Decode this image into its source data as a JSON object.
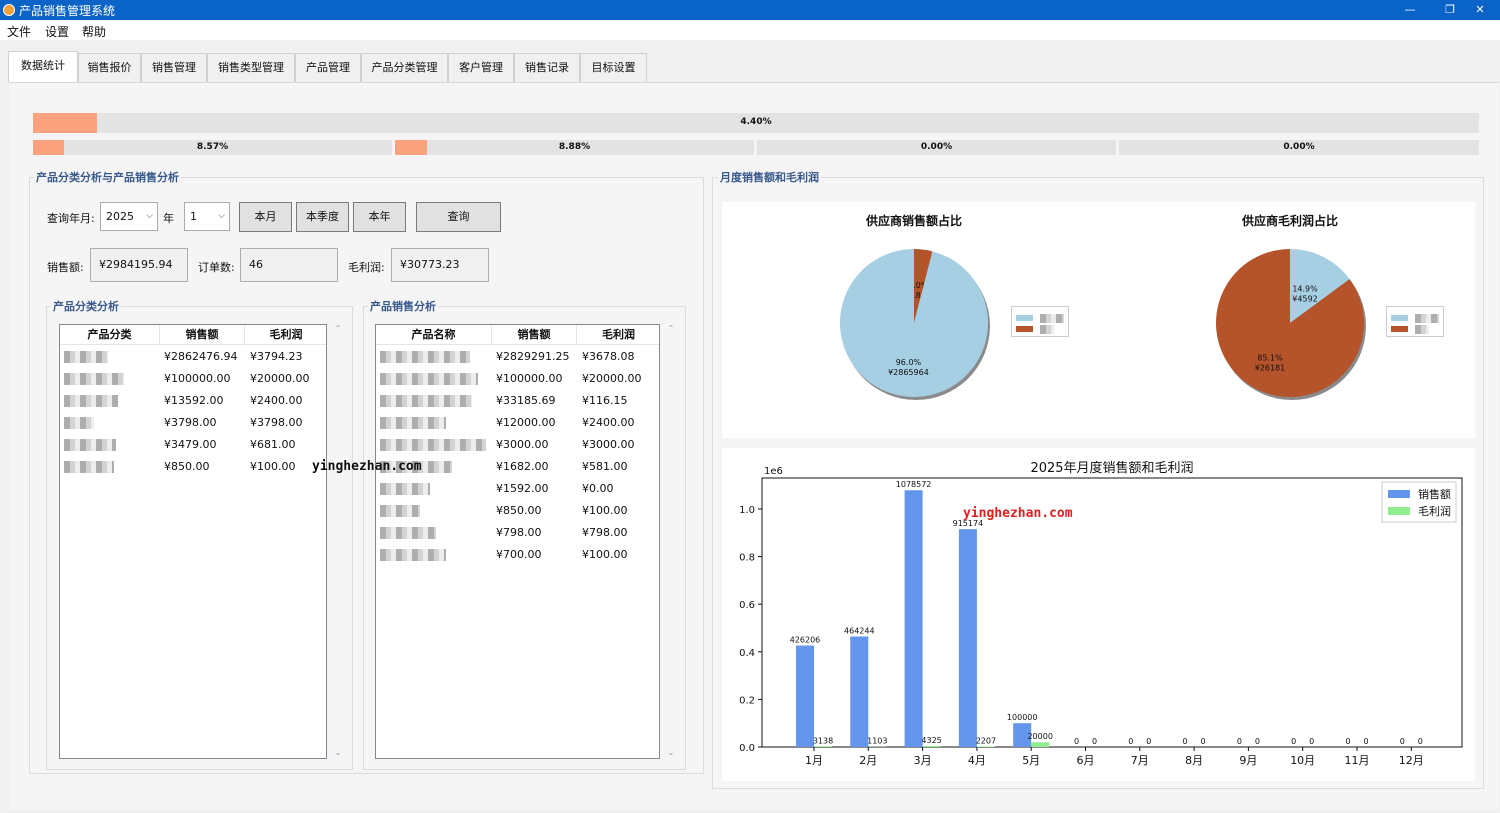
{
  "window": {
    "title": "产品销售管理系统",
    "min_icon": "minimize-icon",
    "max_icon": "maximize-icon",
    "close_icon": "close-icon"
  },
  "menu": [
    "文件",
    "设置",
    "帮助"
  ],
  "tabs": [
    "数据统计",
    "销售报价",
    "销售管理",
    "销售类型管理",
    "产品管理",
    "产品分类管理",
    "客户管理",
    "销售记录",
    "目标设置"
  ],
  "progress": {
    "main": {
      "label": "4.40%",
      "value": 0.044
    },
    "sub": [
      {
        "label": "8.57%",
        "value": 0.0857
      },
      {
        "label": "8.88%",
        "value": 0.0888
      },
      {
        "label": "0.00%",
        "value": 0
      },
      {
        "label": "0.00%",
        "value": 0
      }
    ]
  },
  "left": {
    "title": "产品分类分析与产品销售分析",
    "query_label": "查询年月:",
    "year_value": "2025",
    "year_suffix": "年",
    "month_value": "1",
    "buttons": {
      "month": "本月",
      "quarter": "本季度",
      "year": "本年",
      "query": "查询"
    },
    "sales_label": "销售额:",
    "sales_value": "¥2984195.94",
    "orders_label": "订单数:",
    "orders_value": "46",
    "profit_label": "毛利润:",
    "profit_value": "¥30773.23"
  },
  "category_analysis": {
    "title": "产品分类分析",
    "headers": [
      "产品分类",
      "销售额",
      "毛利润"
    ],
    "rows": [
      [
        "",
        "¥2862476.94",
        "¥3794.23"
      ],
      [
        "",
        "¥100000.00",
        "¥20000.00"
      ],
      [
        "",
        "¥13592.00",
        "¥2400.00"
      ],
      [
        "",
        "¥3798.00",
        "¥3798.00"
      ],
      [
        "",
        "¥3479.00",
        "¥681.00"
      ],
      [
        "",
        "¥850.00",
        "¥100.00"
      ]
    ]
  },
  "product_analysis": {
    "title": "产品销售分析",
    "headers": [
      "产品名称",
      "销售额",
      "毛利润"
    ],
    "rows": [
      [
        "",
        "¥2829291.25",
        "¥3678.08"
      ],
      [
        "",
        "¥100000.00",
        "¥20000.00"
      ],
      [
        "",
        "¥33185.69",
        "¥116.15"
      ],
      [
        "",
        "¥12000.00",
        "¥2400.00"
      ],
      [
        "",
        "¥3000.00",
        "¥3000.00"
      ],
      [
        "",
        "¥1682.00",
        "¥581.00"
      ],
      [
        "",
        "¥1592.00",
        "¥0.00"
      ],
      [
        "",
        "¥850.00",
        "¥100.00"
      ],
      [
        "",
        "¥798.00",
        "¥798.00"
      ],
      [
        "",
        "¥700.00",
        "¥100.00"
      ]
    ]
  },
  "right": {
    "title": "月度销售额和毛利润"
  },
  "pies": [
    {
      "title": "供应商销售额占比",
      "slices": [
        {
          "pct": 4.0,
          "label1": "4.0%",
          "label2": "¥118232",
          "color": "#b5542a"
        },
        {
          "pct": 96.0,
          "label1": "96.0%",
          "label2": "¥2865964",
          "color": "#a6cfe3"
        }
      ]
    },
    {
      "title": "供应商毛利润占比",
      "slices": [
        {
          "pct": 14.9,
          "label1": "14.9%",
          "label2": "¥4592",
          "color": "#a6cfe3"
        },
        {
          "pct": 85.1,
          "label1": "85.1%",
          "label2": "¥26181",
          "color": "#b5542a"
        }
      ]
    }
  ],
  "chart_data": {
    "type": "bar",
    "title": "2025年月度销售额和毛利润",
    "xlabel": "",
    "ylabel": "",
    "y_multiplier": "1e6",
    "ylim": [
      0,
      1.13
    ],
    "yticks": [
      "0.0",
      "0.2",
      "0.4",
      "0.6",
      "0.8",
      "1.0"
    ],
    "categories": [
      "1月",
      "2月",
      "3月",
      "4月",
      "5月",
      "6月",
      "7月",
      "8月",
      "9月",
      "10月",
      "11月",
      "12月"
    ],
    "series": [
      {
        "name": "销售额",
        "color": "#6495ed",
        "values": [
          426206,
          464244,
          1078572,
          915174,
          100000,
          0,
          0,
          0,
          0,
          0,
          0,
          0
        ]
      },
      {
        "name": "毛利润",
        "color": "#90ee90",
        "values": [
          3138,
          1103,
          4325,
          2207,
          20000,
          0,
          0,
          0,
          0,
          0,
          0,
          0
        ]
      }
    ],
    "legend": "top-right",
    "grid": false
  },
  "watermarks": [
    "yinghezhan.com",
    "yinghezhan.com"
  ]
}
